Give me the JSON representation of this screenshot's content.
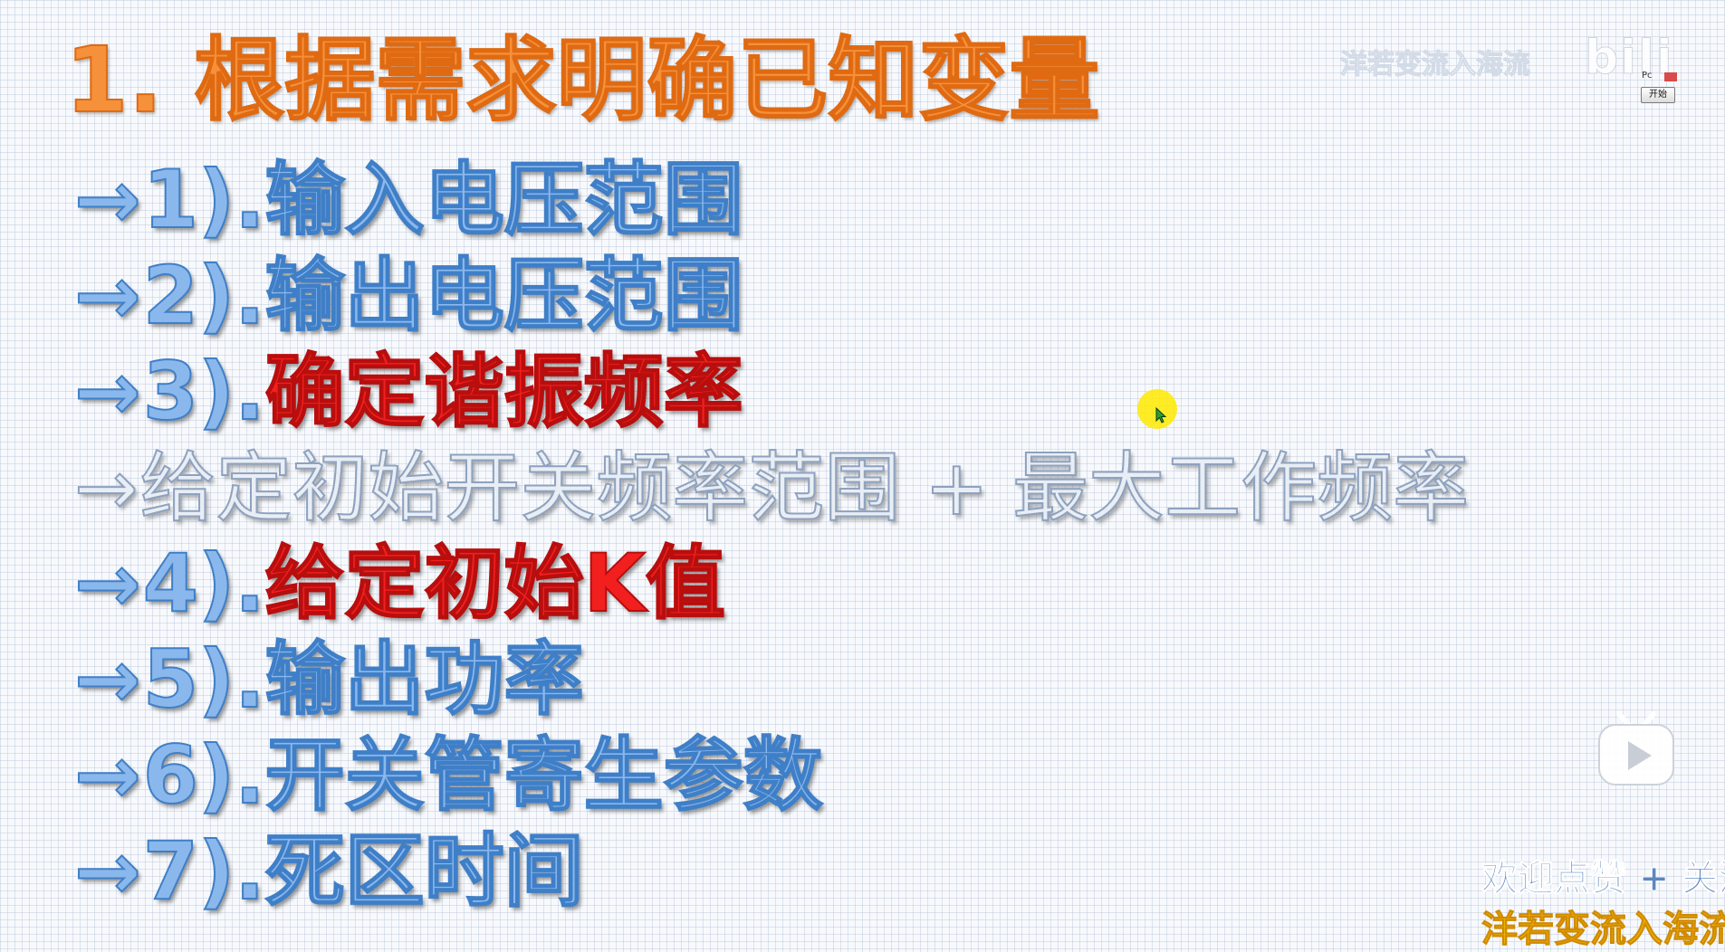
{
  "slide": {
    "title": "1. 根据需求明确已知变量",
    "items": [
      {
        "arrow": "→",
        "num": "1). ",
        "text": "输入电压范围"
      },
      {
        "arrow": "→",
        "num": "2). ",
        "text": "输出电压范围"
      },
      {
        "arrow": "→",
        "num": "3). ",
        "text": "确定谐振频率"
      },
      {
        "arrow": "→",
        "text": "给定初始开关频率范围 + 最大工作频率"
      },
      {
        "arrow": "→",
        "num": "4). ",
        "text": "给定初始K值"
      },
      {
        "arrow": "→",
        "num": "5). ",
        "text": "输出功率"
      },
      {
        "arrow": "→",
        "num": "6). ",
        "text": "开关管寄生参数"
      },
      {
        "arrow": "→",
        "num": "7). ",
        "text": "死区时间"
      }
    ]
  },
  "overlay": {
    "watermark": "洋若变流入海流",
    "logo": "bili",
    "widget_code": "Pc",
    "start_label": "开始",
    "follow_text": "欢迎点赞 + 关注",
    "brand_text": "洋若变流入海流"
  },
  "colors": {
    "title": "#f5913a",
    "item_blue": "#8ab8ec",
    "item_red": "#f21f1f",
    "brand": "#f4b800"
  },
  "icons": {
    "play": "play-button-icon",
    "cursor": "mouse-cursor-icon"
  }
}
